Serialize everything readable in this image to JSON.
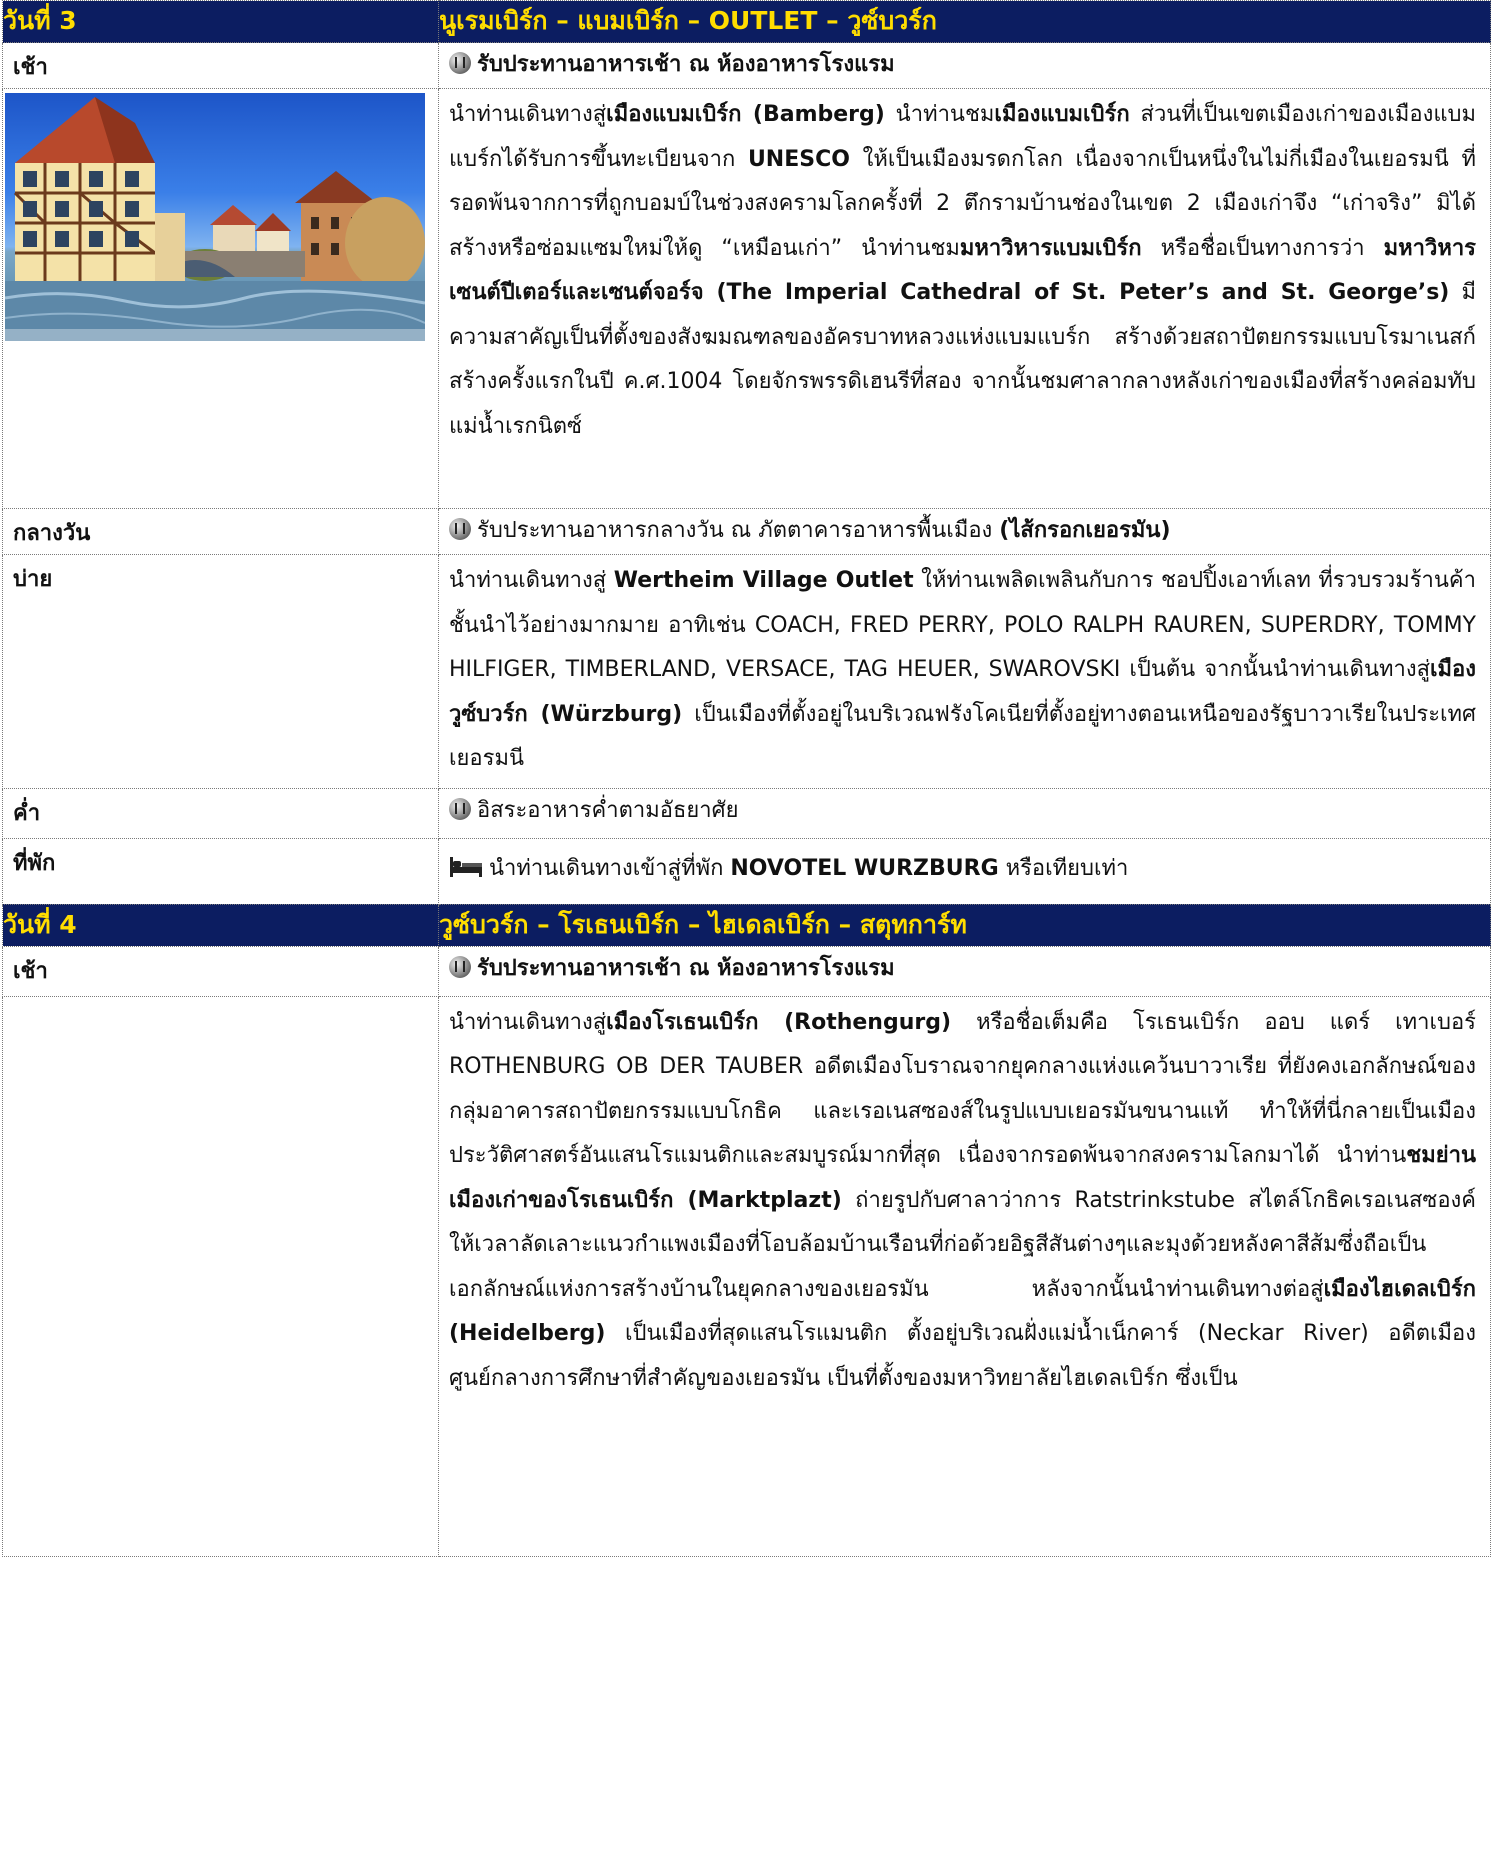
{
  "day3": {
    "day_label": "วันที่ 3",
    "route": "นูเรมเบิร์ก – แบมเบิร์ก – OUTLET – วูซ์บวร์ก",
    "morning": {
      "label": "เช้า",
      "meal": "รับประทานอาหารเช้า ณ ห้องอาหารโรงแรม",
      "meal_icon": "restaurant-icon",
      "image_alt": "Bamberg old town hall on the river",
      "p_a": "นำท่านเดินทางสู่",
      "p_b": "เมืองแบมเบิร์ก (Bamberg)",
      "p_c": " นำท่านชม",
      "p_d": "เมืองแบมเบิร์ก",
      "p_e": " ส่วนที่เป็นเขตเมืองเก่าของเมืองแบมแบร์กได้รับการขึ้นทะเบียนจาก ",
      "p_f": "UNESCO",
      "p_g": " ให้เป็นเมืองมรดกโลก เนื่องจากเป็นหนึ่งในไม่กี่เมืองในเยอรมนี ที่รอดพ้นจากการที่ถูกบอมบ์ในช่วงสงครามโลกครั้งที่ 2 ตึกรามบ้านช่องในเขต 2 เมืองเก่าจึง “เก่าจริง” มิได้สร้างหรือซ่อมแซมใหม่ให้ดู “เหมือนเก่า” นำท่านชม",
      "p_h": "มหาวิหารแบมเบิร์ก",
      "p_i": " หรือชื่อเป็นทางการว่า ",
      "p_j": "มหาวิหารเซนต์ปีเตอร์และเซนต์จอร์จ (The Imperial Cathedral of St. Peter’s and St. George’s)",
      "p_k": " มีความสาคัญเป็นที่ตั้งของสังฆมณฑลของอัครบาทหลวงแห่งแบมแบร์ก สร้างด้วยสถาปัตยกรรมแบบโรมาเนสก์ สร้างครั้งแรกในปี ค.ศ.1004 โดยจักรพรรดิเฮนรีที่สอง จากนั้นชมศาลากลางหลังเก่าของเมืองที่สร้างคล่อมทับแม่น้ำเรกนิตซ์"
    },
    "lunch": {
      "label": "กลางวัน",
      "text": "รับประทานอาหารกลางวัน ณ ภัตตาคารอาหารพื้นเมือง ",
      "bold": "(ไส้กรอกเยอรมัน)"
    },
    "afternoon": {
      "label": "บ่าย",
      "p_a": "นำท่านเดินทางสู่ ",
      "p_b": "Wertheim Village Outlet",
      "p_c": " ให้ท่านเพลิดเพลินกับการ ชอปปิ้งเอาท์เลท ที่รวบรวมร้านค้าชั้นนำไว้อย่างมากมาย อาทิเช่น COACH, FRED PERRY, POLO RALPH RAUREN, SUPERDRY, TOMMY HILFIGER, TIMBERLAND, VERSACE, TAG HEUER, SWAROVSKI เป็นต้น จากนั้นนำท่านเดินทางสู่",
      "p_d": "เมืองวูซ์บวร์ก (Würzburg)",
      "p_e": " เป็นเมืองที่ตั้งอยู่ในบริเวณฟรังโคเนียที่ตั้งอยู่ทางตอนเหนือของรัฐบาวาเรียในประเทศเยอรมนี"
    },
    "dinner": {
      "label": "ค่ำ",
      "text": "อิสระอาหารค่ำตามอัธยาศัย"
    },
    "hotel": {
      "label": "ที่พัก",
      "bed_icon": "bed-icon",
      "text_a": "นำท่านเดินทางเข้าสู่ที่พัก ",
      "text_b": "NOVOTEL WURZBURG",
      "text_c": " หรือเทียบเท่า"
    }
  },
  "day4": {
    "day_label": "วันที่ 4",
    "route": "วูซ์บวร์ก – โรเธนเบิร์ก – ไฮเดลเบิร์ก – สตุทการ์ท",
    "morning": {
      "label": "เช้า",
      "meal": "รับประทานอาหารเช้า ณ ห้องอาหารโรงแรม",
      "p_a": "นำท่านเดินทางสู่",
      "p_b": "เมืองโรเธนเบิร์ก (Rothengurg)",
      "p_c": " หรือชื่อเต็มคือ โรเธนเบิร์ก ออบ แดร์ เทาเบอร์ ROTHENBURG OB DER TAUBER อดีตเมืองโบราณจากยุคกลางแห่งแคว้นบาวาเรีย ที่ยังคงเอกลักษณ์ของกลุ่มอาคารสถาปัตยกรรมแบบโกธิค และเรอเนสซองส์ในรูปแบบเยอรมันขนานแท้ ทำให้ที่นี่กลายเป็นเมืองประวัติศาสตร์อันแสนโรแมนติกและสมบูรณ์มากที่สุด เนื่องจากรอดพ้นจากสงครามโลกมาได้ นำท่าน",
      "p_d": "ชมย่านเมืองเก่าของโรเธนเบิร์ก (Marktplazt)",
      "p_e": " ถ่ายรูปกับศาลาว่าการ Ratstrinkstube สไตล์โกธิคเรอเนสซองค์ ให้เวลาลัดเลาะแนวกำแพงเมืองที่โอบล้อมบ้านเรือนที่ก่อด้วยอิฐสีสันต่างๆและมุงด้วยหลังคาสีส้มซึ่งถือเป็นเอกลักษณ์แห่งการสร้างบ้านในยุคกลางของเยอรมัน หลังจากนั้นนำท่านเดินทางต่อสู่",
      "p_f": "เมืองไฮเดลเบิร์ก (Heidelberg)",
      "p_g": " เป็นเมืองที่สุดแสนโรแมนติก ตั้งอยู่บริเวณฝั่งแม่น้ำเน็กคาร์ (Neckar River) อดีตเมืองศูนย์กลางการศึกษาที่สำคัญของเยอรมัน เป็นที่ตั้งของมหาวิทยาลัยไฮเดลเบิร์ก ซึ่งเป็น"
    }
  },
  "colors": {
    "day_header_bg": "#0c1d61",
    "day_header_text": "#ffdd00"
  }
}
